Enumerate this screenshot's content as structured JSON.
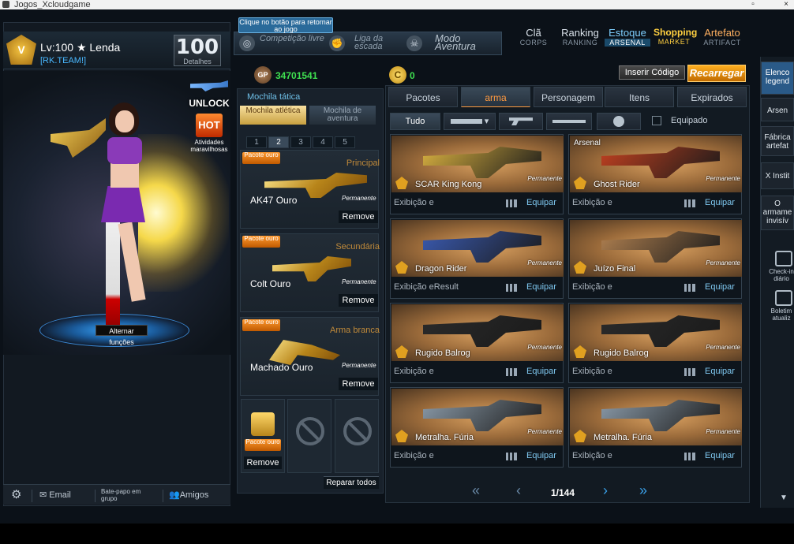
{
  "window": {
    "title": "Jogos_Xcloudgame"
  },
  "profile": {
    "level_text": "Lv:100",
    "rank_text": "★ Lenda",
    "clan": "[RK.TEAM!]",
    "level_badge": "100",
    "level_caption": "Detalhes"
  },
  "promo": {
    "unlock": "UNLOCK",
    "hot": "HOT",
    "hot_label": "Atividades maravilhosas"
  },
  "character": {
    "alt_functions": "Alternar funções"
  },
  "left_footer": {
    "email": "Email",
    "chat": "Bate-papo em grupo",
    "friends": "Amigos"
  },
  "tooltip": "Clique no botão para retornar ao jogo",
  "mode_tabs": [
    {
      "label": "Competição livre"
    },
    {
      "label": "Liga da escada"
    },
    {
      "label": "Modo Aventura"
    }
  ],
  "top_nav": [
    {
      "main": "Clã",
      "sub": "CORPS"
    },
    {
      "main": "Ranking",
      "sub": "RANKING"
    },
    {
      "main": "Estoque",
      "sub": "ARSENAL"
    },
    {
      "main": "Shopping",
      "sub": "MARKET"
    },
    {
      "main": "Artefato",
      "sub": "ARTIFACT"
    }
  ],
  "currency": {
    "gp_label": "GP",
    "gp": "34701541",
    "coin": "0",
    "code_button": "Inserir Código",
    "recharge_button": "Recarregar"
  },
  "backpack": {
    "title": "Mochila tática",
    "tabs": [
      "Mochila atlética",
      "Mochila de aventura"
    ],
    "pages": [
      "1",
      "2",
      "3",
      "4",
      "5"
    ],
    "slots": [
      {
        "badge": "Pacote ouro",
        "category": "Principal",
        "name": "AK47 Ouro",
        "perm": "Permanente",
        "remove": "Remove"
      },
      {
        "badge": "Pacote ouro",
        "category": "Secundária",
        "name": "Colt Ouro",
        "perm": "Permanente",
        "remove": "Remove"
      },
      {
        "badge": "Pacote ouro",
        "category": "Arma branca",
        "name": "Machado Ouro",
        "perm": "Permanente",
        "remove": "Remove"
      }
    ],
    "extra": {
      "badge": "Pacote ouro",
      "remove": "Remove"
    },
    "repair": "Reparar todos"
  },
  "inventory": {
    "tabs": [
      "Pacotes",
      "arma",
      "Personagem",
      "Itens",
      "Expirados"
    ],
    "filter_all": "Tudo",
    "equipped_label": "Equipado",
    "cards": [
      {
        "name": "SCAR King Kong",
        "perm": "Permanente",
        "exib": "Exibição e",
        "equip": "Equipar",
        "tag": "",
        "color": "#d8b040"
      },
      {
        "name": "Ghost Rider",
        "perm": "Permanente",
        "exib": "Exibição e",
        "equip": "Equipar",
        "tag": "Arsenal",
        "color": "#c04020"
      },
      {
        "name": "Dragon Rider",
        "perm": "Permanente",
        "exib": "Exibição eResult",
        "equip": "Equipar",
        "tag": "",
        "color": "#3a5ab0"
      },
      {
        "name": "Juízo Final",
        "perm": "Permanente",
        "exib": "Exibição e",
        "equip": "Equipar",
        "tag": "",
        "color": "#b08050"
      },
      {
        "name": "Rugido Balrog",
        "perm": "Permanente",
        "exib": "Exibição e",
        "equip": "Equipar",
        "tag": "",
        "color": "#2a2a2a"
      },
      {
        "name": "Rugido Balrog",
        "perm": "Permanente",
        "exib": "Exibição e",
        "equip": "Equipar",
        "tag": "",
        "color": "#2a2a2a"
      },
      {
        "name": "Metralha. Fúria",
        "perm": "Permanente",
        "exib": "Exibição e",
        "equip": "Equipar",
        "tag": "",
        "color": "#8a9aa8"
      },
      {
        "name": "Metralha. Fúria",
        "perm": "Permanente",
        "exib": "Exibição e",
        "equip": "Equipar",
        "tag": "",
        "color": "#8a9aa8"
      }
    ],
    "page_text": "1/144"
  },
  "right_sidebar": {
    "items": [
      "Elenco legend",
      "Arsen",
      "Fábrica artefat",
      "X Instit",
      "O armame invisív"
    ],
    "checkin": "Check-in diário",
    "bulletin": "Boletim atualiz"
  }
}
